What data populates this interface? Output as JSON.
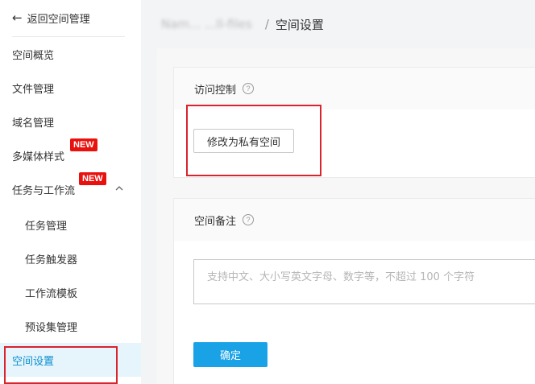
{
  "sidebar": {
    "back_label": "返回空间管理",
    "items": [
      {
        "label": "空间概览"
      },
      {
        "label": "文件管理"
      },
      {
        "label": "域名管理"
      },
      {
        "label": "多媒体样式",
        "badge": "NEW"
      },
      {
        "label": "任务与工作流",
        "badge": "NEW"
      },
      {
        "label": "任务管理"
      },
      {
        "label": "任务触发器"
      },
      {
        "label": "工作流模板"
      },
      {
        "label": "预设集管理"
      },
      {
        "label": "空间设置"
      }
    ]
  },
  "breadcrumb": {
    "parent": "Nam... ...ll-files",
    "separator": "/",
    "current": "空间设置"
  },
  "access": {
    "title": "访问控制",
    "button_label": "修改为私有空间"
  },
  "remark": {
    "title": "空间备注",
    "placeholder": "支持中文、大小写英文字母、数字等，不超过 100 个字符",
    "confirm_label": "确定"
  },
  "colors": {
    "accent": "#1aa2e6",
    "active_text": "#0a8fcf",
    "highlight_box": "#d9232d",
    "badge": "#e8110e"
  }
}
